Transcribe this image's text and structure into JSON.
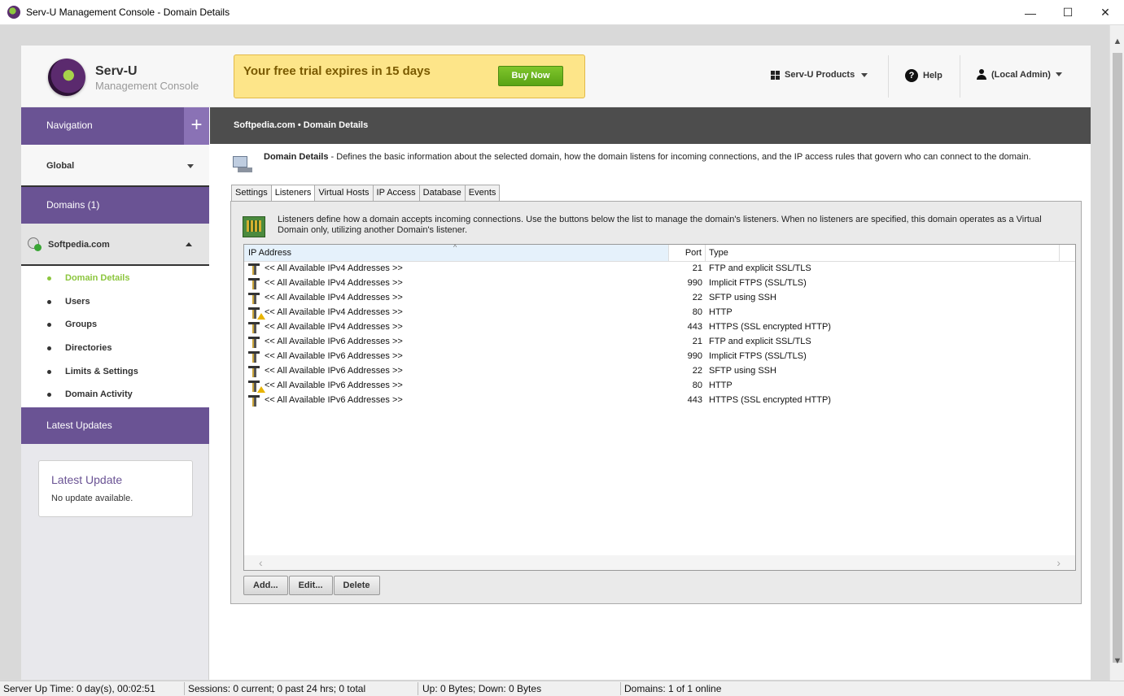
{
  "window": {
    "title": "Serv-U Management Console - Domain Details",
    "controls": {
      "minimize": "—",
      "maximize": "☐",
      "close": "✕"
    }
  },
  "header": {
    "logo_title": "Serv-U",
    "logo_subtitle": "Management Console",
    "trial_message": "Your free trial expires in 15 days",
    "buy_now_label": "Buy Now",
    "products_label": "Serv-U Products",
    "help_label": "Help",
    "user_label": "(Local Admin)"
  },
  "sidebar": {
    "nav_label": "Navigation",
    "nav_plus": "+",
    "global_label": "Global",
    "domains_label": "Domains (1)",
    "domain_name": "Softpedia.com",
    "items": [
      {
        "label": "Domain Details",
        "active": true
      },
      {
        "label": "Users"
      },
      {
        "label": "Groups"
      },
      {
        "label": "Directories"
      },
      {
        "label": "Limits & Settings"
      },
      {
        "label": "Domain Activity"
      }
    ],
    "updates_label": "Latest Updates",
    "update_card_title": "Latest Update",
    "update_card_text": "No update available."
  },
  "breadcrumb": "Softpedia.com • Domain Details",
  "description": {
    "title": "Domain Details",
    "text": " - Defines the basic information about the selected domain, how the domain listens for incoming connections, and the IP access rules that govern who can connect to the domain."
  },
  "tabs": [
    {
      "label": "Settings"
    },
    {
      "label": "Listeners",
      "active": true
    },
    {
      "label": "Virtual Hosts"
    },
    {
      "label": "IP Access"
    },
    {
      "label": "Database"
    },
    {
      "label": "Events"
    }
  ],
  "listeners": {
    "description": "Listeners define how a domain accepts incoming connections. Use the buttons below the list to manage the domain's listeners. When no listeners are specified, this domain operates as a Virtual Domain only, utilizing another Domain's listener.",
    "columns": {
      "ip": "IP Address",
      "port": "Port",
      "type": "Type"
    },
    "sort_indicator": "^",
    "rows": [
      {
        "ip": "<< All Available IPv4 Addresses >>",
        "port": "21",
        "type": "FTP and explicit SSL/TLS",
        "icon": "listener-icon"
      },
      {
        "ip": "<< All Available IPv4 Addresses >>",
        "port": "990",
        "type": "Implicit FTPS (SSL/TLS)",
        "icon": "listener-icon"
      },
      {
        "ip": "<< All Available IPv4 Addresses >>",
        "port": "22",
        "type": "SFTP using SSH",
        "icon": "listener-icon"
      },
      {
        "ip": "<< All Available IPv4 Addresses >>",
        "port": "80",
        "type": "HTTP",
        "icon": "listener-warning-icon"
      },
      {
        "ip": "<< All Available IPv4 Addresses >>",
        "port": "443",
        "type": "HTTPS (SSL encrypted HTTP)",
        "icon": "listener-icon"
      },
      {
        "ip": "<< All Available IPv6 Addresses >>",
        "port": "21",
        "type": "FTP and explicit SSL/TLS",
        "icon": "listener-icon"
      },
      {
        "ip": "<< All Available IPv6 Addresses >>",
        "port": "990",
        "type": "Implicit FTPS (SSL/TLS)",
        "icon": "listener-icon"
      },
      {
        "ip": "<< All Available IPv6 Addresses >>",
        "port": "22",
        "type": "SFTP using SSH",
        "icon": "listener-icon"
      },
      {
        "ip": "<< All Available IPv6 Addresses >>",
        "port": "80",
        "type": "HTTP",
        "icon": "listener-warning-icon"
      },
      {
        "ip": "<< All Available IPv6 Addresses >>",
        "port": "443",
        "type": "HTTPS (SSL encrypted HTTP)",
        "icon": "listener-icon"
      }
    ],
    "scroll_left": "‹",
    "scroll_right": "›",
    "buttons": {
      "add": "Add...",
      "edit": "Edit...",
      "delete": "Delete"
    }
  },
  "statusbar": {
    "uptime": "Server Up Time: 0 day(s), 00:02:51",
    "sessions": "Sessions: 0 current; 0 past 24 hrs; 0 total",
    "transfer": "Up: 0 Bytes; Down: 0 Bytes",
    "domains": "Domains: 1 of 1 online"
  },
  "colors": {
    "purple": "#6a5394",
    "accent_green": "#8cc63e",
    "banner_yellow": "#fde589",
    "breadcrumb_bg": "#4d4d4d"
  }
}
